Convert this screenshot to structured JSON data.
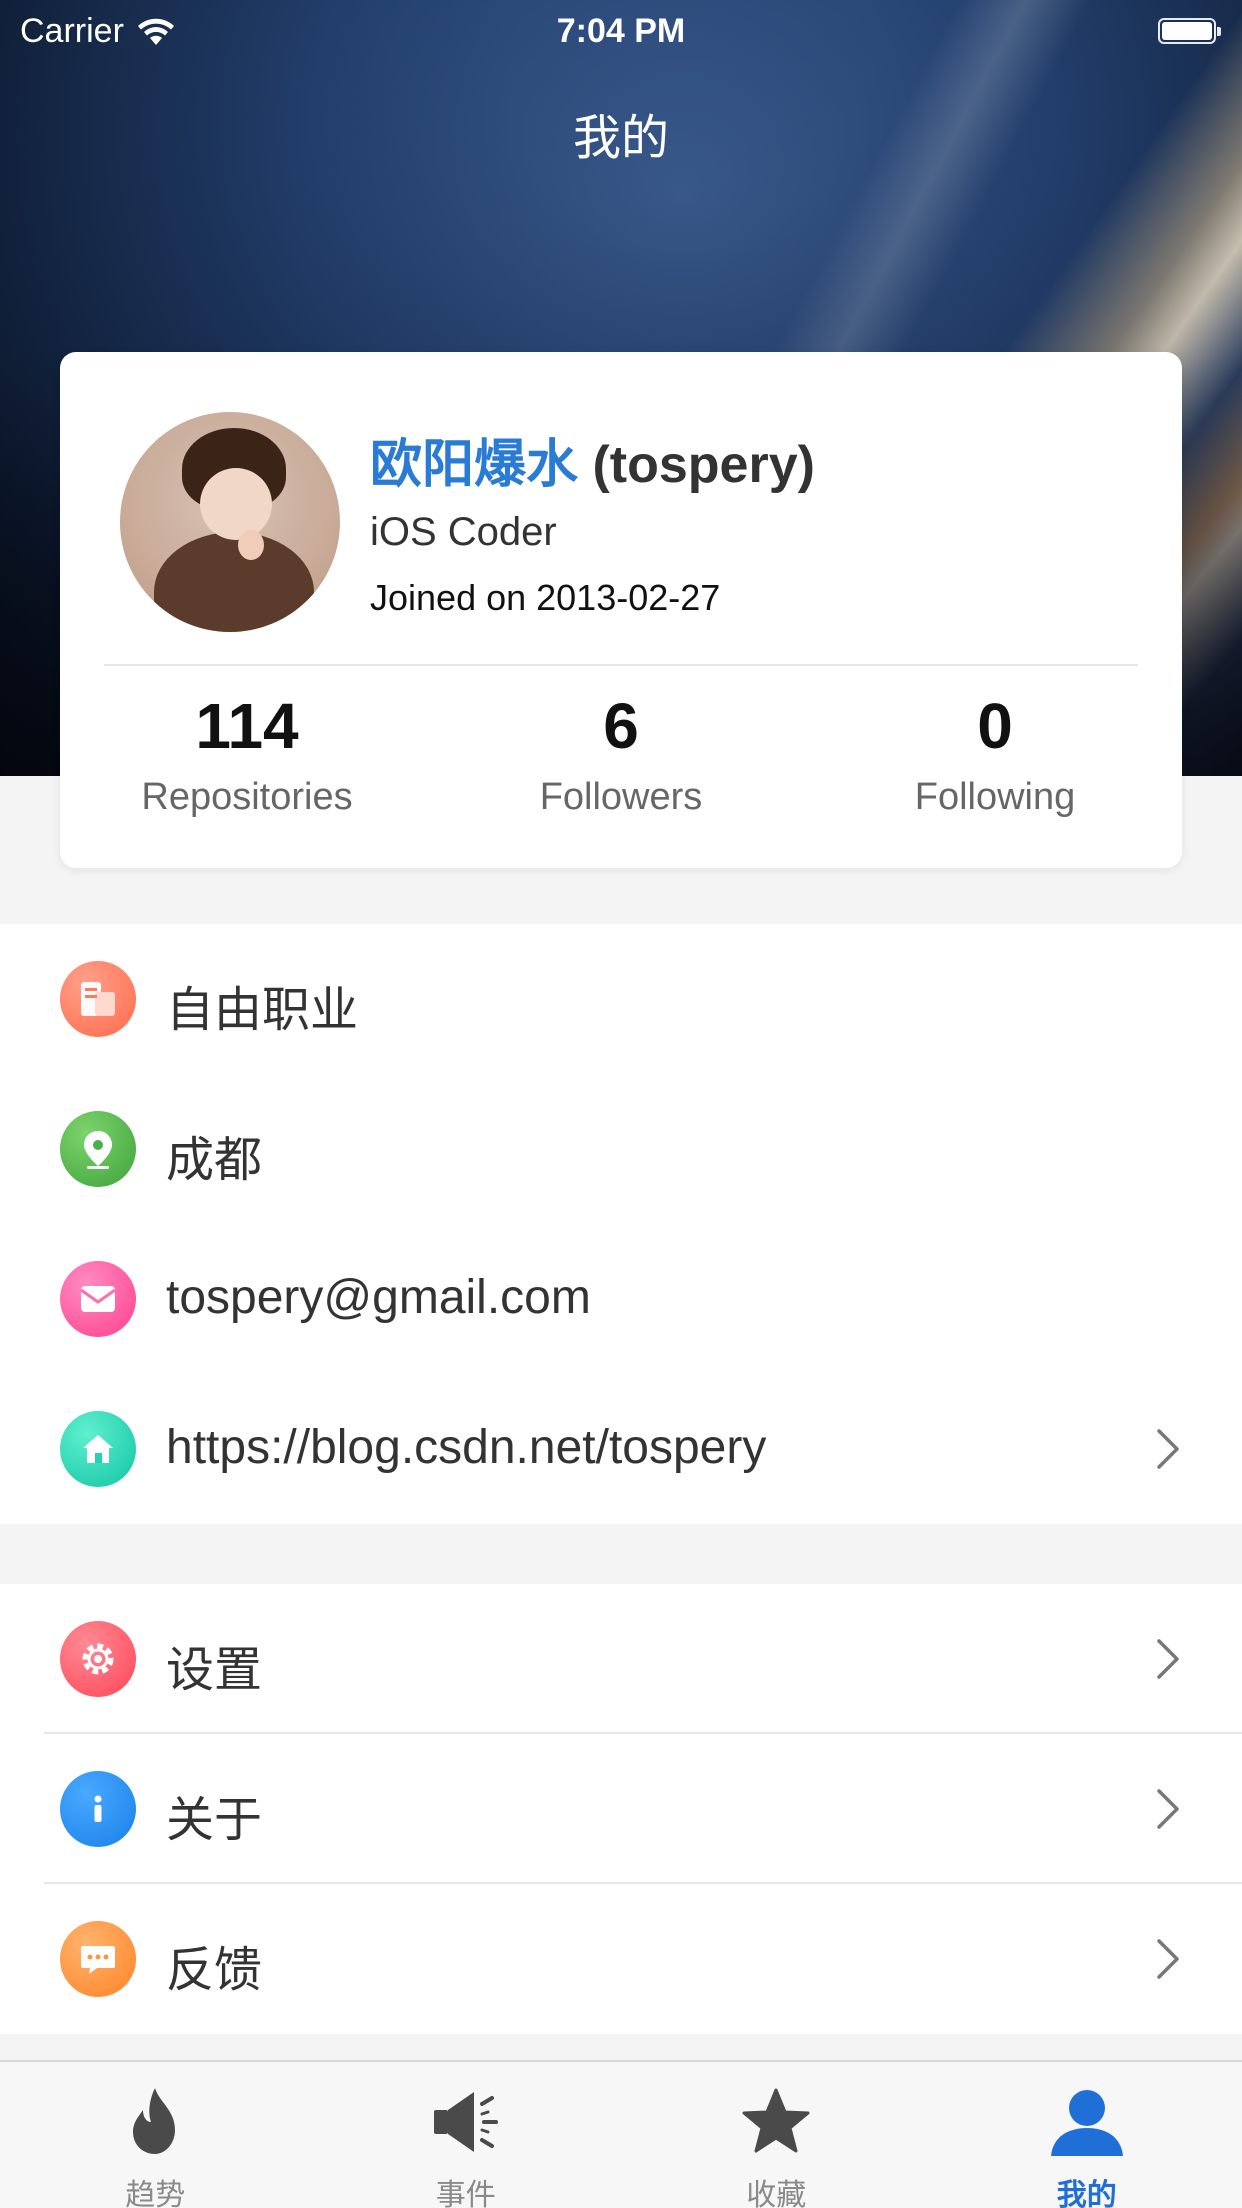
{
  "status_bar": {
    "carrier": "Carrier",
    "time": "7:04 PM"
  },
  "nav": {
    "title": "我的"
  },
  "profile": {
    "name": "欧阳爆水",
    "login": "(tospery)",
    "bio": "iOS Coder",
    "joined": "Joined on 2013-02-27",
    "stats": [
      {
        "value": "114",
        "label": "Repositories"
      },
      {
        "value": "6",
        "label": "Followers"
      },
      {
        "value": "0",
        "label": "Following"
      }
    ]
  },
  "info": {
    "items": [
      {
        "label": "自由职业",
        "icon": "company-icon",
        "color": "#ff7a5c"
      },
      {
        "label": "成都",
        "icon": "location-pin-icon",
        "color": "#4cb04a"
      },
      {
        "label": "tospery@gmail.com",
        "icon": "mail-icon",
        "color": "#ff4f9a"
      },
      {
        "label": "https://blog.csdn.net/tospery",
        "icon": "home-icon",
        "color": "#22d3b0"
      }
    ]
  },
  "menu": {
    "items": [
      {
        "label": "设置",
        "icon": "settings-gear-icon",
        "color": "#ff5c6c"
      },
      {
        "label": "关于",
        "icon": "info-icon",
        "color": "#1e8ff0"
      },
      {
        "label": "反馈",
        "icon": "feedback-chat-icon",
        "color": "#ff9640"
      }
    ]
  },
  "tabs": [
    {
      "label": "趋势",
      "icon": "flame-icon",
      "active": false
    },
    {
      "label": "事件",
      "icon": "megaphone-icon",
      "active": false
    },
    {
      "label": "收藏",
      "icon": "star-icon",
      "active": false
    },
    {
      "label": "我的",
      "icon": "person-icon",
      "active": true
    }
  ],
  "colors": {
    "accent": "#1f6fd6",
    "name_blue": "#2a7bd4",
    "tab_inactive": "#8a8a8a"
  }
}
